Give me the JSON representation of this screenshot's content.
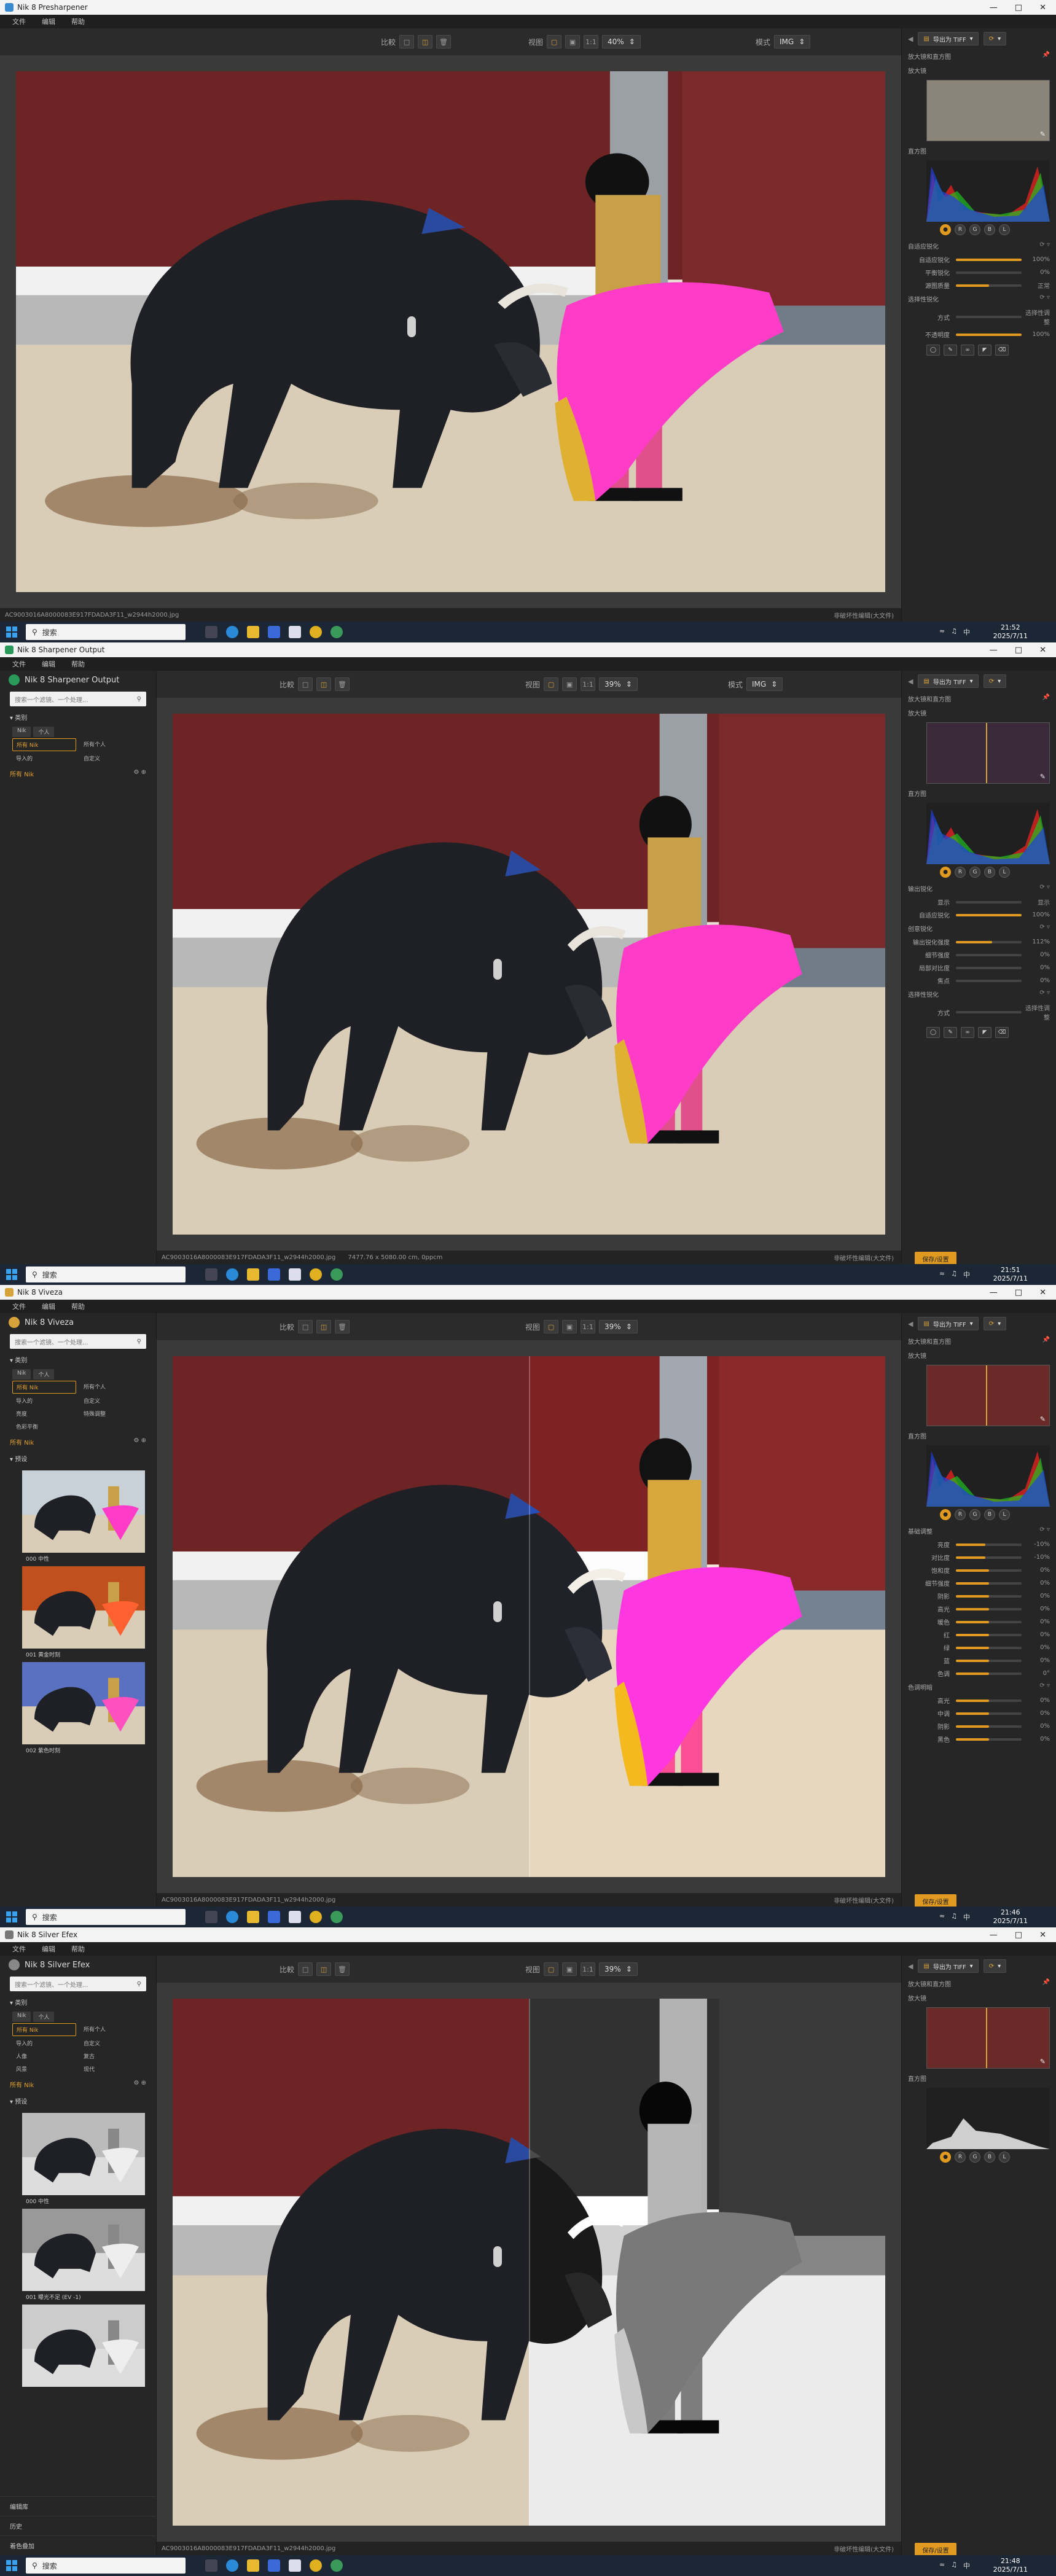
{
  "colors": {
    "accent": "#e09a20",
    "bg": "#262626",
    "canvas": "#3a3a3a",
    "taskbar": "#1c2736"
  },
  "menu": [
    "文件",
    "编辑",
    "帮助"
  ],
  "compare_label": "比較",
  "view_label": "视图",
  "mode_label": "模式",
  "mode_value": "IMG",
  "split_value": "1:1",
  "search_placeholder": "搜索一个滤镜、一个处理...",
  "taskbar": {
    "search": "搜索"
  },
  "statusbar_right": "非破坏性编辑(大文件)",
  "right_panel": {
    "export_label": "导出为 TIFF",
    "navigator_title": "放大镜和直方图",
    "nav_label": "放大镜",
    "histo_label": "直方图",
    "rgb_chips": [
      "R",
      "G",
      "B",
      "L"
    ],
    "loupe_icon": "loupe-icon",
    "save_label": "保存/设置"
  },
  "filename": "AC9003016A8000083E917FDADA3F11_w2944h2000.jpg",
  "screens": [
    {
      "app_title": "Nik 8 Presharpener",
      "zoom": "40%",
      "time": "21:52",
      "date": "2025/7/11",
      "sections": [
        {
          "title": "自适应锐化",
          "rows": [
            {
              "label": "自适应锐化",
              "value": "100%",
              "level": 1.0
            },
            {
              "label": "平衡锐化",
              "value": "0%",
              "level": 0.0
            }
          ]
        },
        {
          "title": "",
          "rows": [
            {
              "label": "源图质量",
              "value": "正常",
              "level": 0.5
            }
          ]
        },
        {
          "title": "选择性锐化",
          "rows": [
            {
              "label": "方式",
              "value": "选择性调整",
              "level": 0.0
            },
            {
              "label": "不透明度",
              "value": "100%",
              "level": 1.0
            }
          ]
        }
      ],
      "left_panel": false
    },
    {
      "app_title": "Nik 8 Sharpener Output",
      "zoom": "39%",
      "time": "21:51",
      "date": "2025/7/11",
      "status_dims": "7477.76 x 5080.00 cm, 0ppcm",
      "filter_tabs": [
        "Nik",
        "个人"
      ],
      "filter_grid": [
        "所有 Nik",
        "所有个人",
        "导入的",
        "自定义"
      ],
      "all_nik": "所有 Nik",
      "sections": [
        {
          "title": "输出锐化",
          "rows": [
            {
              "label": "显示",
              "value": "显示",
              "level": 0.0
            },
            {
              "label": "自适应锐化",
              "value": "100%",
              "level": 1.0
            }
          ]
        },
        {
          "title": "创意锐化",
          "rows": [
            {
              "label": "输出锐化强度",
              "value": "112%",
              "level": 0.55
            },
            {
              "label": "细节强度",
              "value": "0%",
              "level": 0.0
            },
            {
              "label": "局部对比度",
              "value": "0%",
              "level": 0.0
            },
            {
              "label": "焦点",
              "value": "0%",
              "level": 0.0
            }
          ]
        },
        {
          "title": "选择性锐化",
          "rows": [
            {
              "label": "方式",
              "value": "选择性调整",
              "level": 0.0
            }
          ]
        }
      ],
      "left_panel": true
    },
    {
      "app_title": "Nik 8 Viveza",
      "zoom": "39%",
      "time": "21:46",
      "date": "2025/7/11",
      "filter_tabs": [
        "Nik",
        "个人"
      ],
      "filter_grid": [
        "所有 Nik",
        "所有个人",
        "导入的",
        "自定义",
        "亮度",
        "特殊调整",
        "色彩平衡",
        ""
      ],
      "all_nik": "所有 Nik",
      "presets": [
        "000 中性",
        "001 黄金时刻",
        "002 紫色时刻"
      ],
      "sections": [
        {
          "title": "基础调整",
          "rows": [
            {
              "label": "亮度",
              "value": "-10%",
              "level": 0.45
            },
            {
              "label": "对比度",
              "value": "-10%",
              "level": 0.45
            },
            {
              "label": "饱和度",
              "value": "0%",
              "level": 0.5
            },
            {
              "label": "细节强度",
              "value": "0%",
              "level": 0.5
            },
            {
              "label": "阴影",
              "value": "0%",
              "level": 0.5
            },
            {
              "label": "高光",
              "value": "0%",
              "level": 0.5
            },
            {
              "label": "暖色",
              "value": "0%",
              "level": 0.5
            },
            {
              "label": "红",
              "value": "0%",
              "level": 0.5
            },
            {
              "label": "绿",
              "value": "0%",
              "level": 0.5
            },
            {
              "label": "蓝",
              "value": "0%",
              "level": 0.5
            },
            {
              "label": "色调",
              "value": "0°",
              "level": 0.5
            }
          ]
        },
        {
          "title": "色调明暗",
          "rows": [
            {
              "label": "高光",
              "value": "0%",
              "level": 0.5
            },
            {
              "label": "中调",
              "value": "0%",
              "level": 0.5
            },
            {
              "label": "阴影",
              "value": "0%",
              "level": 0.5
            },
            {
              "label": "黑色",
              "value": "0%",
              "level": 0.5
            }
          ]
        }
      ],
      "left_panel": true
    },
    {
      "app_title": "Nik 8 Silver Efex",
      "zoom": "39%",
      "time": "21:48",
      "date": "2025/7/11",
      "filter_tabs": [
        "Nik",
        "个人"
      ],
      "filter_grid": [
        "所有 Nik",
        "所有个人",
        "导入的",
        "自定义",
        "人像",
        "复古",
        "风景",
        "现代"
      ],
      "all_nik": "所有 Nik",
      "presets": [
        "000 中性",
        "001 曝光不足 (EV -1)",
        ""
      ],
      "footer": [
        "编辑库",
        "历史",
        "着色叠加"
      ],
      "sections": [],
      "left_panel": true
    }
  ]
}
